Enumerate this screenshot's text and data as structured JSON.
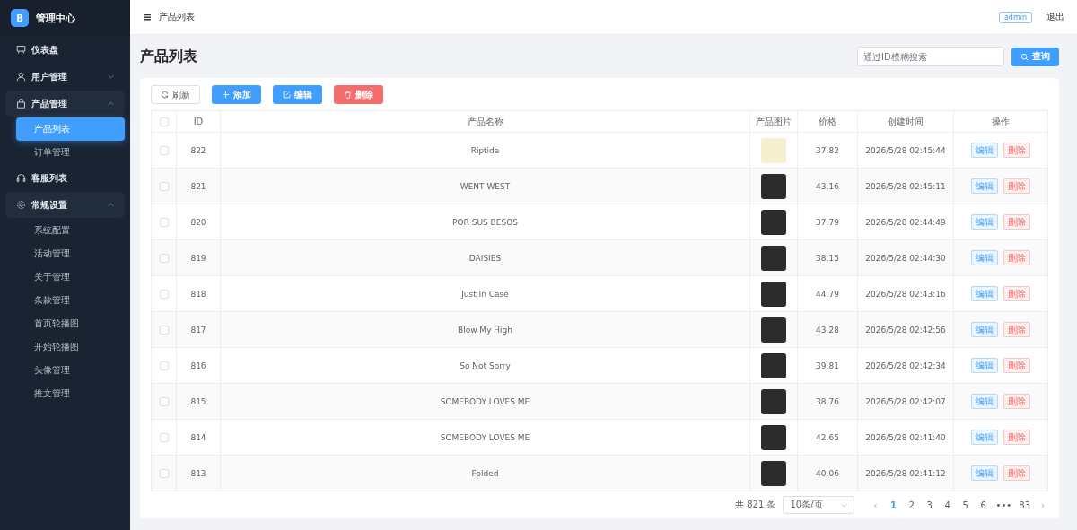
{
  "brand": {
    "logo": "B",
    "title": "管理中心"
  },
  "sidebar": {
    "items": [
      {
        "label": "仪表盘"
      },
      {
        "label": "用户管理",
        "expanded": false
      },
      {
        "label": "产品管理",
        "expanded": true,
        "children": [
          {
            "label": "产品列表",
            "selected": true
          },
          {
            "label": "订单管理",
            "selected": false
          }
        ]
      },
      {
        "label": "客服列表"
      },
      {
        "label": "常规设置",
        "expanded": true,
        "children": [
          {
            "label": "系统配置",
            "selected": false
          },
          {
            "label": "活动管理",
            "selected": false
          },
          {
            "label": "关于管理",
            "selected": false
          },
          {
            "label": "条款管理",
            "selected": false
          },
          {
            "label": "首页轮播图",
            "selected": false
          },
          {
            "label": "开始轮播图",
            "selected": false
          },
          {
            "label": "头像管理",
            "selected": false
          },
          {
            "label": "推文管理",
            "selected": false
          }
        ]
      }
    ]
  },
  "header": {
    "menu_glyph": "≡",
    "breadcrumb": "产品列表",
    "user": "admin",
    "logout": "退出"
  },
  "page": {
    "title": "产品列表",
    "search": {
      "placeholder": "通过ID模糊搜索"
    },
    "search_button": "查询"
  },
  "toolbar": [
    {
      "label": "刷新",
      "kind": "refresh"
    },
    {
      "label": "添加",
      "kind": "add"
    },
    {
      "label": "编辑",
      "kind": "edit"
    },
    {
      "label": "删除",
      "kind": "delete"
    }
  ],
  "table": {
    "select_all_checked": false,
    "columns": [
      "ID",
      "产品名称",
      "产品图片",
      "价格",
      "创建时间",
      "操作"
    ],
    "rows": [
      {
        "checked": false,
        "id": "822",
        "name": "Riptide",
        "price": "37.82",
        "created": "2026/5/28 02:45:44",
        "edit": "编辑",
        "delete": "删除"
      },
      {
        "checked": false,
        "id": "821",
        "name": "WENT WEST",
        "price": "43.16",
        "created": "2026/5/28 02:45:11",
        "edit": "编辑",
        "delete": "删除"
      },
      {
        "checked": false,
        "id": "820",
        "name": "POR SUS BESOS",
        "price": "37.79",
        "created": "2026/5/28 02:44:49",
        "edit": "编辑",
        "delete": "删除"
      },
      {
        "checked": false,
        "id": "819",
        "name": "DAISIES",
        "price": "38.15",
        "created": "2026/5/28 02:44:30",
        "edit": "编辑",
        "delete": "删除"
      },
      {
        "checked": false,
        "id": "818",
        "name": "Just In Case",
        "price": "44.79",
        "created": "2026/5/28 02:43:16",
        "edit": "编辑",
        "delete": "删除"
      },
      {
        "checked": false,
        "id": "817",
        "name": "Blow My High",
        "price": "43.28",
        "created": "2026/5/28 02:42:56",
        "edit": "编辑",
        "delete": "删除"
      },
      {
        "checked": false,
        "id": "816",
        "name": "So Not Sorry",
        "price": "39.81",
        "created": "2026/5/28 02:42:34",
        "edit": "编辑",
        "delete": "删除"
      },
      {
        "checked": false,
        "id": "815",
        "name": "SOMEBODY LOVES ME",
        "price": "38.76",
        "created": "2026/5/28 02:42:07",
        "edit": "编辑",
        "delete": "删除"
      },
      {
        "checked": false,
        "id": "814",
        "name": "SOMEBODY LOVES ME",
        "price": "42.65",
        "created": "2026/5/28 02:41:40",
        "edit": "编辑",
        "delete": "删除"
      },
      {
        "checked": false,
        "id": "813",
        "name": "Folded",
        "price": "40.06",
        "created": "2026/5/28 02:41:12",
        "edit": "编辑",
        "delete": "删除"
      }
    ]
  },
  "pagination": {
    "total": "共 821 条",
    "page_size": "10条/页",
    "prev": "‹",
    "pages": [
      {
        "label": "1",
        "selected": true
      },
      {
        "label": "2",
        "selected": false
      },
      {
        "label": "3",
        "selected": false
      },
      {
        "label": "4",
        "selected": false
      },
      {
        "label": "5",
        "selected": false
      },
      {
        "label": "6",
        "selected": false
      },
      {
        "label": "•••",
        "selected": false
      },
      {
        "label": "83",
        "selected": false
      }
    ],
    "next": "›"
  }
}
